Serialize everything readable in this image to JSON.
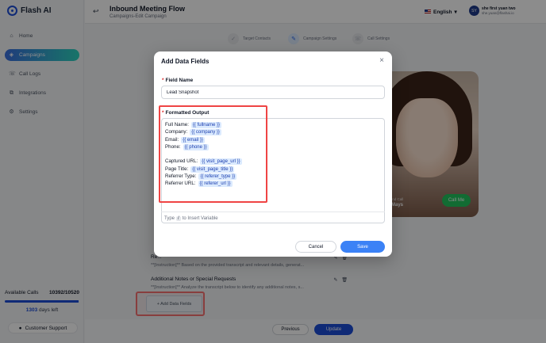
{
  "app": {
    "name": "Flash AI"
  },
  "sidebar": {
    "items": [
      {
        "label": "Home",
        "icon": "home-icon"
      },
      {
        "label": "Campaigns",
        "icon": "megaphone-icon",
        "active": true
      },
      {
        "label": "Call Logs",
        "icon": "phone-icon"
      },
      {
        "label": "Integrations",
        "icon": "integrations-icon"
      },
      {
        "label": "Settings",
        "icon": "gear-icon"
      }
    ],
    "available_calls_label": "Available Calls",
    "available_calls_value": "10392/10520",
    "available_calls_used_fraction": 0.988,
    "days_value": "1303",
    "days_label": "days left",
    "support_label": "Customer Support"
  },
  "header": {
    "title": "Inbound Meeting Flow",
    "subtitle": "Campaigns-Edit Campaign",
    "language": "English",
    "user_name": "she first yuan two",
    "user_email": "she.yuan@flashai.io",
    "avatar_initials": "SY"
  },
  "steps": [
    {
      "label": "Target Contacts",
      "state": "done"
    },
    {
      "label": "Campaign Settings",
      "state": "active"
    },
    {
      "label": "Call Settings",
      "state": "pending"
    }
  ],
  "background_fields": [
    {
      "title": "Re...",
      "desc": "**[Instruction]** Based on the provided transcript and relevant details, generat..."
    },
    {
      "title": "Additional Notes or Special Requests",
      "desc": "**[Instruction]** Analyze the transcript below to identify any additional notes, s..."
    }
  ],
  "add_data_fields_label": "+ Add Data Fields",
  "preview": {
    "label": "Inbound Call",
    "name": "Mays",
    "call_button": "Call Me"
  },
  "footer": {
    "previous_label": "Previous",
    "update_label": "Update"
  },
  "modal": {
    "title": "Add Data Fields",
    "field_name_label": "Field Name",
    "field_name_value": "Lead Snapshot",
    "formatted_output_label": "Formatted Output",
    "lines": [
      {
        "key": "Full Name:",
        "var": "{{ fullname }}"
      },
      {
        "key": "Company:",
        "var": "{{ company }}"
      },
      {
        "key": "Email:",
        "var": "{{ email }}"
      },
      {
        "key": "Phone:",
        "var": "{{ phone }}"
      },
      {
        "key": "",
        "var": ""
      },
      {
        "key": "Captured URL:",
        "var": "{{ visit_page_url }}"
      },
      {
        "key": "Page Title:",
        "var": "{{ visit_page_title }}"
      },
      {
        "key": "Referrer Type:",
        "var": "{{ referer_type }}"
      },
      {
        "key": "Referrer URL:",
        "var": "{{ referer_url }}"
      }
    ],
    "hint_prefix": "Type",
    "hint_key": "/",
    "hint_suffix": "to Insert Variable",
    "cancel_label": "Cancel",
    "save_label": "Save"
  }
}
